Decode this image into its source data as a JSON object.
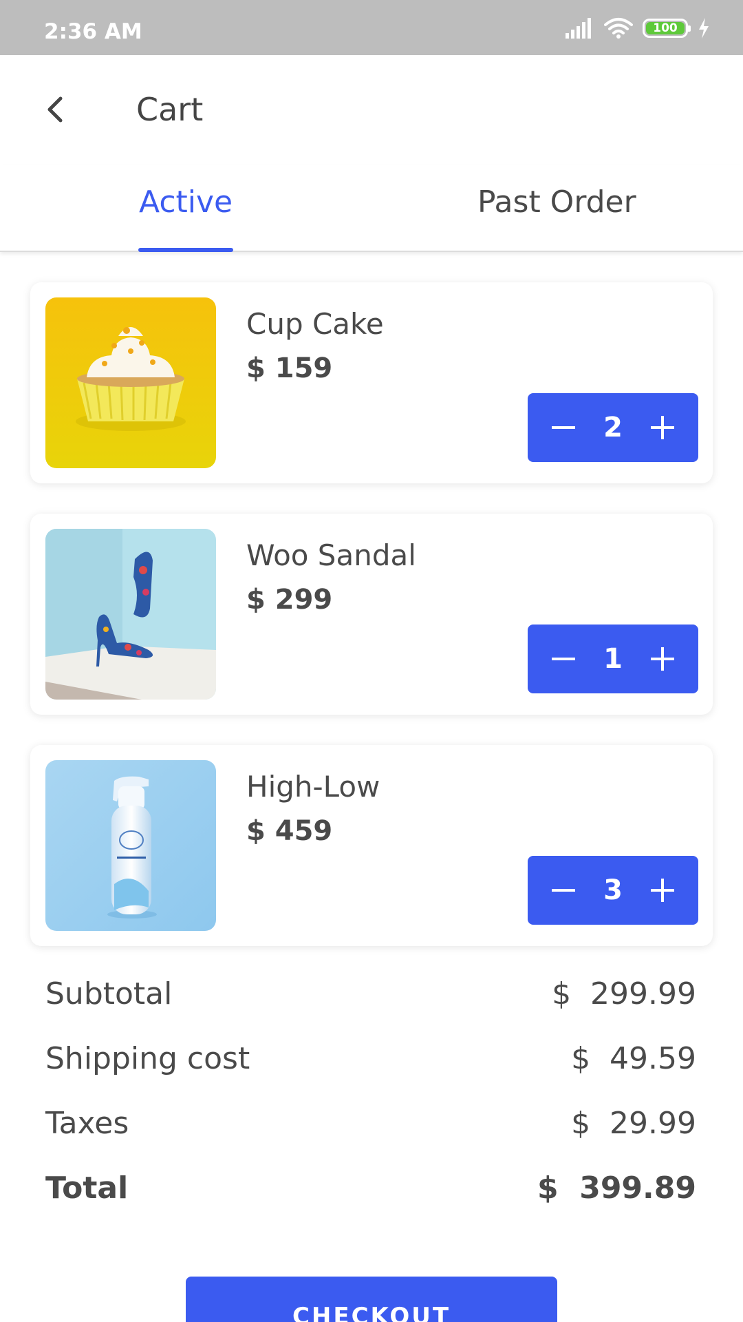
{
  "status_bar": {
    "time": "2:36 AM",
    "battery": "100"
  },
  "header": {
    "title": "Cart",
    "back_icon": "chevron-left-icon"
  },
  "tabs": [
    {
      "label": "Active",
      "active": true
    },
    {
      "label": "Past Order",
      "active": false
    }
  ],
  "cart": {
    "items": [
      {
        "name": "Cup Cake",
        "price": "$ 159",
        "quantity": "2",
        "image": "cupcake-image"
      },
      {
        "name": "Woo Sandal",
        "price": "$ 299",
        "quantity": "1",
        "image": "sandal-image"
      },
      {
        "name": "High-Low",
        "price": "$ 459",
        "quantity": "3",
        "image": "spray-bottle-image"
      }
    ]
  },
  "summary": {
    "subtotal": {
      "label": "Subtotal",
      "value": "$  299.99"
    },
    "shipping": {
      "label": "Shipping cost",
      "value": "$  49.59"
    },
    "taxes": {
      "label": "Taxes",
      "value": "$  29.99"
    },
    "total": {
      "label": "Total",
      "value": "$  399.89"
    }
  },
  "checkout": {
    "label": "CHECKOUT"
  },
  "colors": {
    "accent": "#3b5bf0",
    "text": "#4a4a4a",
    "status_bar": "#bdbdbd"
  }
}
